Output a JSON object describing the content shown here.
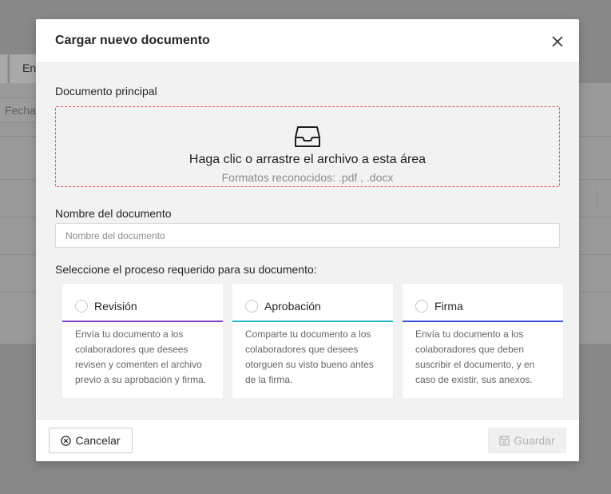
{
  "background": {
    "tab_label": "En",
    "filter_placeholder": "Fecha"
  },
  "modal": {
    "title": "Cargar nuevo documento",
    "close_icon": "close-icon",
    "main_document_label": "Documento principal",
    "dropzone": {
      "icon": "inbox-icon",
      "text": "Haga clic o arrastre el archivo a esta área",
      "hint": "Formatos reconocidos: .pdf ,  .docx",
      "border_color": "#e05252"
    },
    "name_label": "Nombre del documento",
    "name_placeholder": "Nombre del documento",
    "name_value": "",
    "process_label": "Seleccione el proceso requerido para su documento:",
    "processes": [
      {
        "title": "Revisión",
        "color": "#7b3fc4",
        "description": "Envía tu documento a los colaboradores que desees revisen y comenten el archivo previo a su aprobación y firma.",
        "selected": false
      },
      {
        "title": "Aprobación",
        "color": "#1fb8c4",
        "description": "Comparte tu documento a los colaboradores que desees otorguen su visto bueno antes de la firma.",
        "selected": false
      },
      {
        "title": "Firma",
        "color": "#3a50d6",
        "description": "Envía tu documento a los colaboradores que deben suscribir el documento, y en caso de existir, sus anexos.",
        "selected": false
      }
    ],
    "footer": {
      "cancel_label": "Cancelar",
      "cancel_icon": "close-circle-icon",
      "save_label": "Guardar",
      "save_icon": "save-icon",
      "save_disabled": true
    }
  }
}
